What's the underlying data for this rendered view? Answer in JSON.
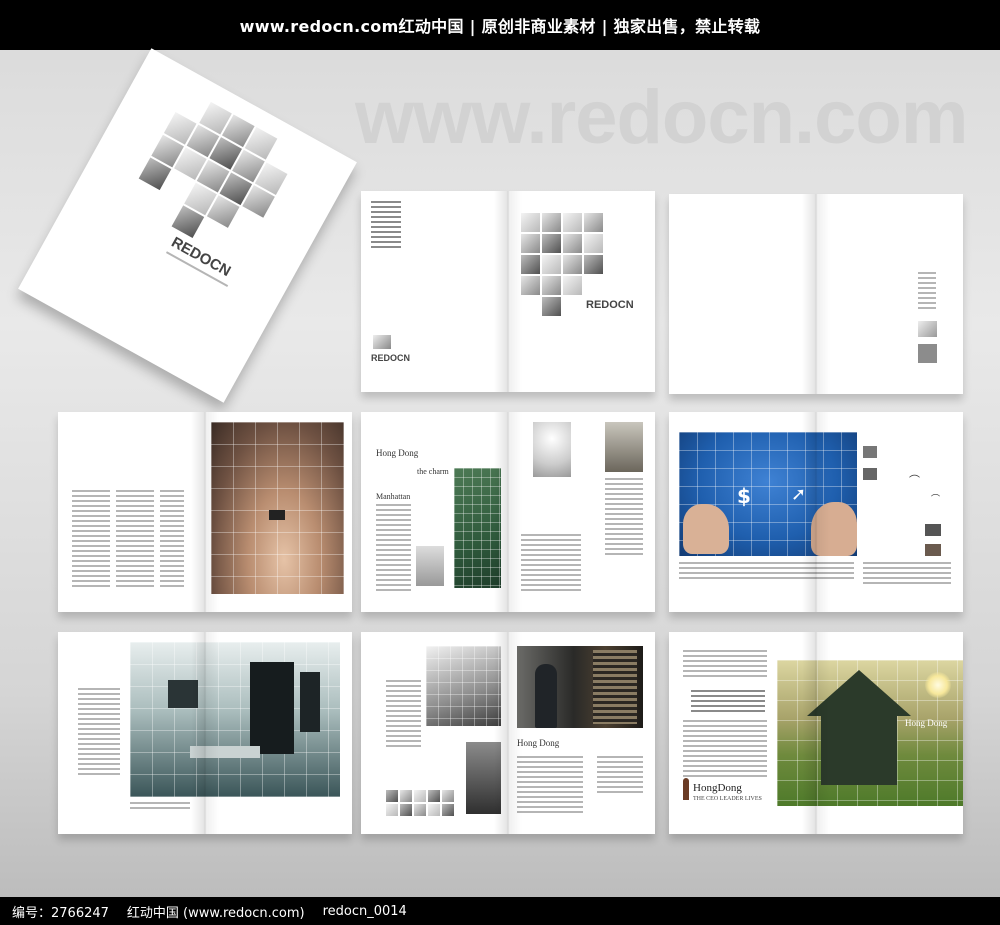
{
  "header": {
    "title": "www.redocn.com红动中国 | 原创非商业素材 | 独家出售，禁止转载"
  },
  "watermark": {
    "text": "www.redocn.com"
  },
  "cover": {
    "brand": "REDOCN"
  },
  "spreads": {
    "s1": {
      "brand_right": "REDOCN",
      "brand_left": "REDOCN"
    },
    "s4": {
      "heading": "Hong Dong",
      "sub1": "the charm",
      "sub2": "Manhattan"
    },
    "s8": {
      "heading": "Hong Dong"
    },
    "s9": {
      "heading_right": "Hong Dong",
      "heading_left": "HongDong",
      "tagline": "THE CEO LEADER LIVES"
    }
  },
  "footer": {
    "id_label": "编号：2766247",
    "site": "红动中国 (www.redocn.com)",
    "code": "redocn_0014"
  },
  "colors": {
    "bar": "#000000",
    "watermark": "#d2d2d2",
    "accent_blue": "#1f5fae"
  }
}
